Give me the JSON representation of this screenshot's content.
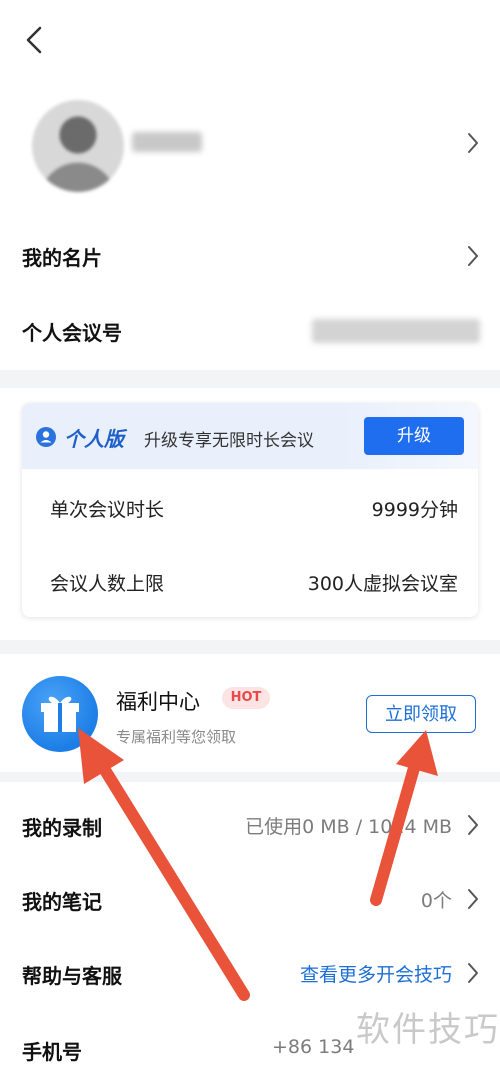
{
  "header": {
    "back_icon": "chevron-left-icon"
  },
  "profile": {
    "avatar": "avatar-blurred",
    "chevron": "chevron-right-icon"
  },
  "rows_top": {
    "card_label": "我的名片",
    "meeting_id_label": "个人会议号"
  },
  "plan_card": {
    "plan_name": "个人版",
    "plan_desc": "升级专享无限时长会议",
    "upgrade_label": "升级",
    "duration_label": "单次会议时长",
    "duration_value": "9999分钟",
    "capacity_label": "会议人数上限",
    "capacity_value": "300人虚拟会议室",
    "accent": "#1f6ef0"
  },
  "welfare": {
    "title": "福利中心",
    "hot": "HOT",
    "subtitle": "专属福利等您领取",
    "claim_label": "立即领取",
    "icon": "gift-icon"
  },
  "rows_bottom": {
    "recording_label": "我的录制",
    "recording_value": "已使用0 MB / 1024 MB",
    "notes_label": "我的笔记",
    "notes_value": "0个",
    "help_label": "帮助与客服",
    "help_value": "查看更多开会技巧",
    "phone_label": "手机号",
    "phone_value": "+86 134"
  },
  "watermark": "软件技巧",
  "colors": {
    "arrow": "#e8533a",
    "link": "#1d6fd6",
    "hot": "#e84a4a"
  }
}
